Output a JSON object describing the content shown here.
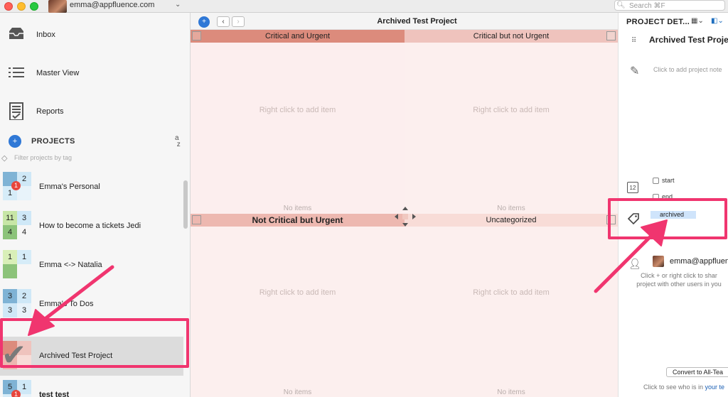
{
  "titlebar": {
    "account_email": "emma@appfluence.com",
    "search_placeholder": "Search ⌘F"
  },
  "sidebar": {
    "nav": [
      {
        "label": "Inbox",
        "icon": "inbox-icon"
      },
      {
        "label": "Master View",
        "icon": "list-icon"
      },
      {
        "label": "Reports",
        "icon": "report-icon"
      }
    ],
    "projects_title": "PROJECTS",
    "filter_placeholder": "Filter projects by tag",
    "projects": [
      {
        "name": "Emma's Personal",
        "cells": [
          "",
          "2",
          "1",
          ""
        ],
        "badge": "1",
        "selected": false,
        "bold": false
      },
      {
        "name": "How to become a tickets Jedi",
        "cells": [
          "11",
          "3",
          "4",
          "4"
        ],
        "badge": "",
        "selected": false,
        "bold": false
      },
      {
        "name": "Emma <-> Natalia",
        "cells": [
          "1",
          "1",
          "",
          ""
        ],
        "badge": "",
        "selected": false,
        "bold": false
      },
      {
        "name": "Emma's To Dos",
        "cells": [
          "3",
          "2",
          "3",
          "3"
        ],
        "badge": "",
        "selected": false,
        "bold": false
      },
      {
        "name": "Archived Test Project",
        "cells": [
          "",
          "",
          "",
          ""
        ],
        "badge": "",
        "selected": true,
        "bold": false
      },
      {
        "name": "test test",
        "cells": [
          "5",
          "1",
          "",
          ""
        ],
        "badge": "1",
        "selected": false,
        "bold": true
      }
    ]
  },
  "main": {
    "title": "Archived Test Project",
    "quadrants": [
      {
        "title": "Critical and Urgent",
        "hint": "Right click to add item",
        "empty": "No items"
      },
      {
        "title": "Critical but not Urgent",
        "hint": "Right click to add item",
        "empty": "No items"
      },
      {
        "title": "Not Critical but Urgent",
        "hint": "Right click to add item",
        "empty": "No items"
      },
      {
        "title": "Uncategorized",
        "hint": "Right click to add item",
        "empty": "No items"
      }
    ]
  },
  "details": {
    "header": "PROJECT DET...",
    "project_name": "Archived Test Proje",
    "notes_placeholder": "Click to add project note",
    "start_label": "start",
    "end_label": "end",
    "tag": "archived",
    "user": "emma@appfluenc",
    "share_hint_1": "Click + or right click to shar",
    "share_hint_2": "project with other users in you",
    "convert_button": "Convert to All-Tea",
    "bottom_text": "Click to see who is in ",
    "bottom_link": "your te"
  },
  "colors": {
    "highlight": "#f0356f",
    "accent": "#2f78d6",
    "q1_header": "#dc8b7c",
    "q2_header": "#efc3bd",
    "q3_header": "#edb8b0",
    "q4_header": "#f8dcd7",
    "quad_bg": "#fcefee"
  }
}
